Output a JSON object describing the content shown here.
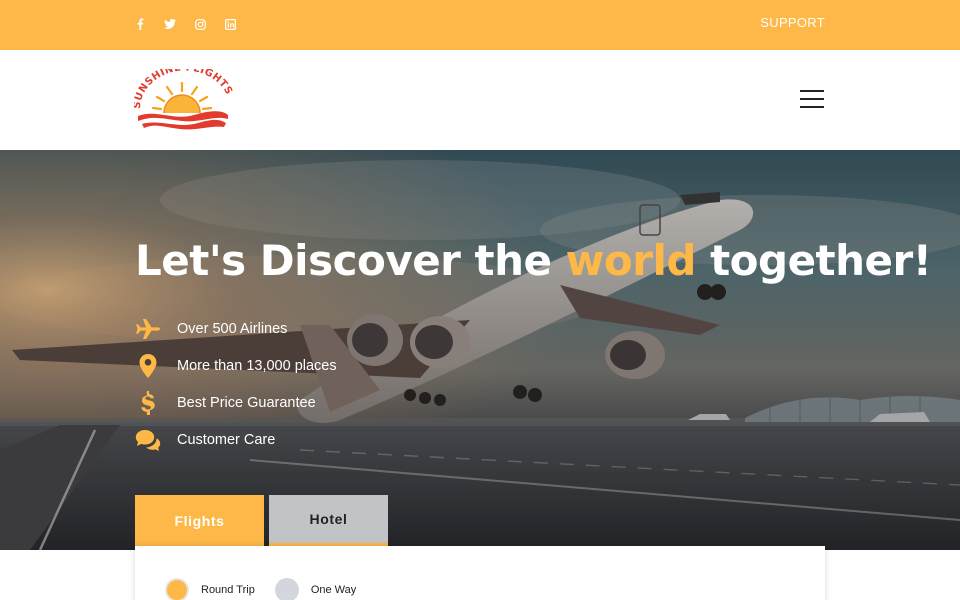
{
  "topbar": {
    "social": [
      {
        "icon": "facebook-icon",
        "glyph": "f"
      },
      {
        "icon": "twitter-icon"
      },
      {
        "icon": "instagram-icon"
      },
      {
        "icon": "linkedin-icon",
        "glyph": "in"
      }
    ],
    "support_label": "SUPPORT"
  },
  "header": {
    "logo_text": "SUNSHINE FLIGHTS",
    "menu_icon": "hamburger-menu-icon"
  },
  "hero": {
    "title_before": "Let's Discover the ",
    "title_accent": "world",
    "title_after": " together!",
    "features": [
      {
        "icon": "airplane-icon",
        "label": "Over 500 Airlines"
      },
      {
        "icon": "map-pin-icon",
        "label": "More than 13,000 places"
      },
      {
        "icon": "dollar-icon",
        "label": "Best Price Guarantee"
      },
      {
        "icon": "chat-bubbles-icon",
        "label": "Customer Care"
      }
    ]
  },
  "tabs": [
    {
      "label": "Flights",
      "active": true
    },
    {
      "label": "Hotel",
      "active": false
    }
  ],
  "search": {
    "trip_types": [
      {
        "label": "Round Trip",
        "checked": true
      },
      {
        "label": "One Way",
        "checked": false
      }
    ]
  },
  "colors": {
    "accent": "#fdb848",
    "hotel_tab": "#c2c3c6",
    "white": "#ffffff"
  }
}
